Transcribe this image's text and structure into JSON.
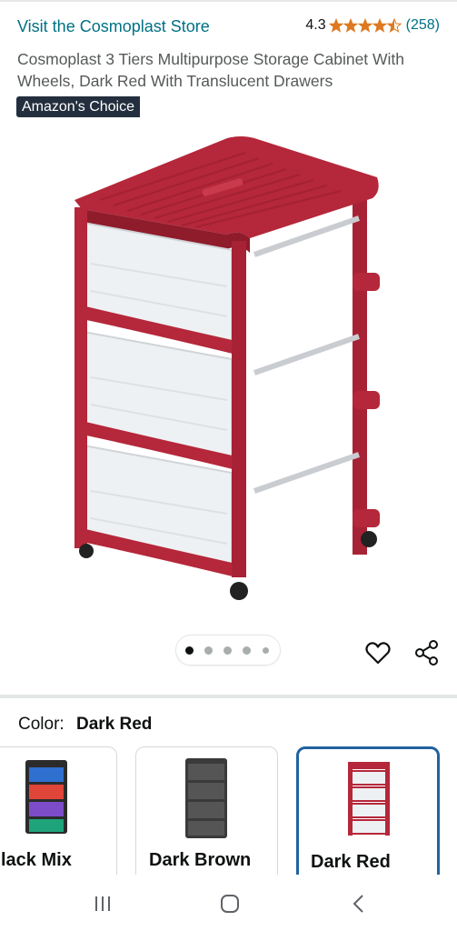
{
  "header": {
    "store_link": "Visit the Cosmoplast Store",
    "rating_value": "4.3",
    "rating_stars": 4.3,
    "rating_count": "(258)"
  },
  "product": {
    "title": "Cosmoplast 3 Tiers Multipurpose Storage Cabinet With Wheels, Dark Red With Translucent Drawers",
    "badge": "Amazon's Choice",
    "image_count": 5,
    "active_image": 1
  },
  "color_selector": {
    "label": "Color:",
    "selected_value": "Dark Red",
    "options": [
      {
        "name": "Black Mix",
        "visible_name": "lack Mix"
      },
      {
        "name": "Dark Brown",
        "visible_name": "Dark Brown"
      },
      {
        "name": "Dark Red",
        "visible_name": "Dark Red",
        "selected": true
      }
    ]
  },
  "colors": {
    "link": "#007185",
    "star": "#de7921",
    "badge_bg": "#232f3e",
    "selected_border": "#2162a1",
    "cabinet_red": "#b5273a"
  },
  "icons": {
    "wishlist": "heart-icon",
    "share": "share-icon",
    "nav_recent": "recent-apps-icon",
    "nav_home": "home-icon",
    "nav_back": "back-icon"
  }
}
